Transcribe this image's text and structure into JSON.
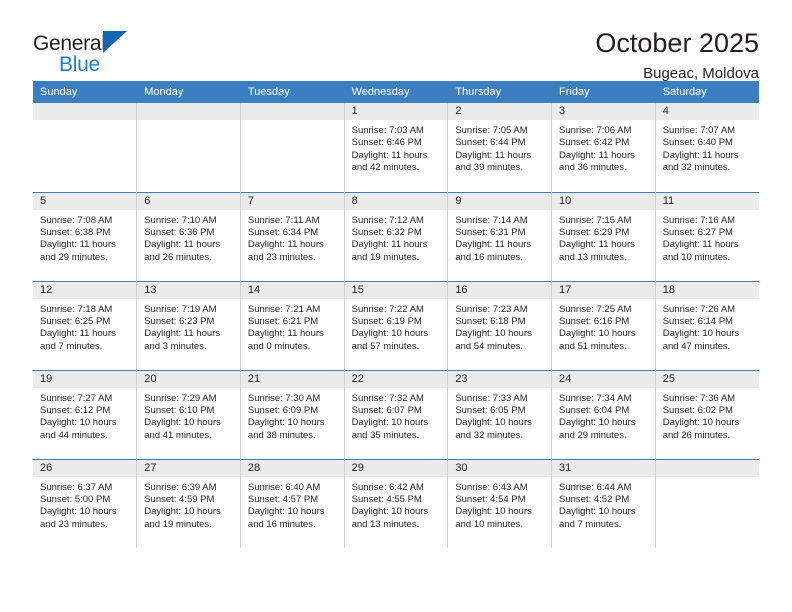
{
  "brand": {
    "name_part1": "General",
    "name_part2": "Blue",
    "logo_icon": "triangle-icon"
  },
  "header": {
    "title": "October 2025",
    "subtitle": "Bugeac, Moldova"
  },
  "calendar": {
    "weekday_headers": [
      "Sunday",
      "Monday",
      "Tuesday",
      "Wednesday",
      "Thursday",
      "Friday",
      "Saturday"
    ],
    "colors": {
      "header_background": "#3c7fc1",
      "header_text": "#ffffff",
      "daynum_background": "#ebebeb",
      "cell_text": "#231f20",
      "brand_blue": "#1f7fd4",
      "logo_triangle": "#1265b0"
    },
    "weeks": [
      [
        {
          "day": "",
          "empty": true
        },
        {
          "day": "",
          "empty": true
        },
        {
          "day": "",
          "empty": true
        },
        {
          "day": "1",
          "sunrise": "Sunrise: 7:03 AM",
          "sunset": "Sunset: 6:46 PM",
          "daylight_line1": "Daylight: 11 hours",
          "daylight_line2": "and 42 minutes."
        },
        {
          "day": "2",
          "sunrise": "Sunrise: 7:05 AM",
          "sunset": "Sunset: 6:44 PM",
          "daylight_line1": "Daylight: 11 hours",
          "daylight_line2": "and 39 minutes."
        },
        {
          "day": "3",
          "sunrise": "Sunrise: 7:06 AM",
          "sunset": "Sunset: 6:42 PM",
          "daylight_line1": "Daylight: 11 hours",
          "daylight_line2": "and 36 minutes."
        },
        {
          "day": "4",
          "sunrise": "Sunrise: 7:07 AM",
          "sunset": "Sunset: 6:40 PM",
          "daylight_line1": "Daylight: 11 hours",
          "daylight_line2": "and 32 minutes."
        }
      ],
      [
        {
          "day": "5",
          "sunrise": "Sunrise: 7:08 AM",
          "sunset": "Sunset: 6:38 PM",
          "daylight_line1": "Daylight: 11 hours",
          "daylight_line2": "and 29 minutes."
        },
        {
          "day": "6",
          "sunrise": "Sunrise: 7:10 AM",
          "sunset": "Sunset: 6:36 PM",
          "daylight_line1": "Daylight: 11 hours",
          "daylight_line2": "and 26 minutes."
        },
        {
          "day": "7",
          "sunrise": "Sunrise: 7:11 AM",
          "sunset": "Sunset: 6:34 PM",
          "daylight_line1": "Daylight: 11 hours",
          "daylight_line2": "and 23 minutes."
        },
        {
          "day": "8",
          "sunrise": "Sunrise: 7:12 AM",
          "sunset": "Sunset: 6:32 PM",
          "daylight_line1": "Daylight: 11 hours",
          "daylight_line2": "and 19 minutes."
        },
        {
          "day": "9",
          "sunrise": "Sunrise: 7:14 AM",
          "sunset": "Sunset: 6:31 PM",
          "daylight_line1": "Daylight: 11 hours",
          "daylight_line2": "and 16 minutes."
        },
        {
          "day": "10",
          "sunrise": "Sunrise: 7:15 AM",
          "sunset": "Sunset: 6:29 PM",
          "daylight_line1": "Daylight: 11 hours",
          "daylight_line2": "and 13 minutes."
        },
        {
          "day": "11",
          "sunrise": "Sunrise: 7:16 AM",
          "sunset": "Sunset: 6:27 PM",
          "daylight_line1": "Daylight: 11 hours",
          "daylight_line2": "and 10 minutes."
        }
      ],
      [
        {
          "day": "12",
          "sunrise": "Sunrise: 7:18 AM",
          "sunset": "Sunset: 6:25 PM",
          "daylight_line1": "Daylight: 11 hours",
          "daylight_line2": "and 7 minutes."
        },
        {
          "day": "13",
          "sunrise": "Sunrise: 7:19 AM",
          "sunset": "Sunset: 6:23 PM",
          "daylight_line1": "Daylight: 11 hours",
          "daylight_line2": "and 3 minutes."
        },
        {
          "day": "14",
          "sunrise": "Sunrise: 7:21 AM",
          "sunset": "Sunset: 6:21 PM",
          "daylight_line1": "Daylight: 11 hours",
          "daylight_line2": "and 0 minutes."
        },
        {
          "day": "15",
          "sunrise": "Sunrise: 7:22 AM",
          "sunset": "Sunset: 6:19 PM",
          "daylight_line1": "Daylight: 10 hours",
          "daylight_line2": "and 57 minutes."
        },
        {
          "day": "16",
          "sunrise": "Sunrise: 7:23 AM",
          "sunset": "Sunset: 6:18 PM",
          "daylight_line1": "Daylight: 10 hours",
          "daylight_line2": "and 54 minutes."
        },
        {
          "day": "17",
          "sunrise": "Sunrise: 7:25 AM",
          "sunset": "Sunset: 6:16 PM",
          "daylight_line1": "Daylight: 10 hours",
          "daylight_line2": "and 51 minutes."
        },
        {
          "day": "18",
          "sunrise": "Sunrise: 7:26 AM",
          "sunset": "Sunset: 6:14 PM",
          "daylight_line1": "Daylight: 10 hours",
          "daylight_line2": "and 47 minutes."
        }
      ],
      [
        {
          "day": "19",
          "sunrise": "Sunrise: 7:27 AM",
          "sunset": "Sunset: 6:12 PM",
          "daylight_line1": "Daylight: 10 hours",
          "daylight_line2": "and 44 minutes."
        },
        {
          "day": "20",
          "sunrise": "Sunrise: 7:29 AM",
          "sunset": "Sunset: 6:10 PM",
          "daylight_line1": "Daylight: 10 hours",
          "daylight_line2": "and 41 minutes."
        },
        {
          "day": "21",
          "sunrise": "Sunrise: 7:30 AM",
          "sunset": "Sunset: 6:09 PM",
          "daylight_line1": "Daylight: 10 hours",
          "daylight_line2": "and 38 minutes."
        },
        {
          "day": "22",
          "sunrise": "Sunrise: 7:32 AM",
          "sunset": "Sunset: 6:07 PM",
          "daylight_line1": "Daylight: 10 hours",
          "daylight_line2": "and 35 minutes."
        },
        {
          "day": "23",
          "sunrise": "Sunrise: 7:33 AM",
          "sunset": "Sunset: 6:05 PM",
          "daylight_line1": "Daylight: 10 hours",
          "daylight_line2": "and 32 minutes."
        },
        {
          "day": "24",
          "sunrise": "Sunrise: 7:34 AM",
          "sunset": "Sunset: 6:04 PM",
          "daylight_line1": "Daylight: 10 hours",
          "daylight_line2": "and 29 minutes."
        },
        {
          "day": "25",
          "sunrise": "Sunrise: 7:36 AM",
          "sunset": "Sunset: 6:02 PM",
          "daylight_line1": "Daylight: 10 hours",
          "daylight_line2": "and 26 minutes."
        }
      ],
      [
        {
          "day": "26",
          "sunrise": "Sunrise: 6:37 AM",
          "sunset": "Sunset: 5:00 PM",
          "daylight_line1": "Daylight: 10 hours",
          "daylight_line2": "and 23 minutes."
        },
        {
          "day": "27",
          "sunrise": "Sunrise: 6:39 AM",
          "sunset": "Sunset: 4:59 PM",
          "daylight_line1": "Daylight: 10 hours",
          "daylight_line2": "and 19 minutes."
        },
        {
          "day": "28",
          "sunrise": "Sunrise: 6:40 AM",
          "sunset": "Sunset: 4:57 PM",
          "daylight_line1": "Daylight: 10 hours",
          "daylight_line2": "and 16 minutes."
        },
        {
          "day": "29",
          "sunrise": "Sunrise: 6:42 AM",
          "sunset": "Sunset: 4:55 PM",
          "daylight_line1": "Daylight: 10 hours",
          "daylight_line2": "and 13 minutes."
        },
        {
          "day": "30",
          "sunrise": "Sunrise: 6:43 AM",
          "sunset": "Sunset: 4:54 PM",
          "daylight_line1": "Daylight: 10 hours",
          "daylight_line2": "and 10 minutes."
        },
        {
          "day": "31",
          "sunrise": "Sunrise: 6:44 AM",
          "sunset": "Sunset: 4:52 PM",
          "daylight_line1": "Daylight: 10 hours",
          "daylight_line2": "and 7 minutes."
        },
        {
          "day": "",
          "empty": true
        }
      ]
    ]
  }
}
